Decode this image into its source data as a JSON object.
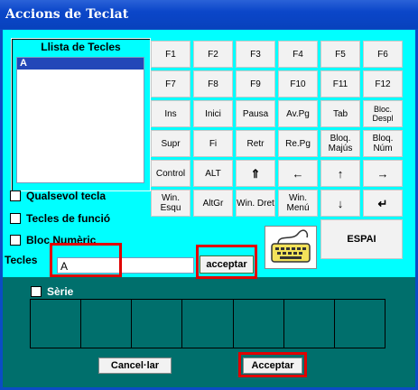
{
  "window": {
    "title": "Accions de Teclat"
  },
  "list": {
    "label": "Llista de Tecles",
    "items": [
      "A"
    ]
  },
  "keys": {
    "row1": [
      "F1",
      "F2",
      "F3",
      "F4",
      "F5",
      "F6"
    ],
    "row2": [
      "F7",
      "F8",
      "F9",
      "F10",
      "F11",
      "F12"
    ],
    "row3": [
      "Ins",
      "Inici",
      "Pausa",
      "Av.Pg",
      "Tab",
      "Bloc. Despl"
    ],
    "row4": [
      "Supr",
      "Fi",
      "Retr",
      "Re.Pg",
      "Bloq. Majús",
      "Bloq. Núm"
    ],
    "row5": [
      "Control",
      "ALT",
      "⇑",
      "←",
      "↑",
      "→"
    ],
    "row6": [
      "Win. Esqu",
      "AltGr",
      "Win. Dret",
      "Win. Menú",
      "↓",
      "↵"
    ],
    "space": "ESPAI"
  },
  "options": {
    "qualsevol": "Qualsevol tecla",
    "funcio": "Tecles de funció",
    "numeric": "Bloc Numèric"
  },
  "tecles": {
    "label": "Tecles",
    "value": "A",
    "button": "acceptar"
  },
  "serie": {
    "label": "Sèrie"
  },
  "footer": {
    "cancel": "Cancel·lar",
    "accept": "Acceptar"
  },
  "colors": {
    "panel": "#00ffff",
    "lower": "#006f6c",
    "highlight": "#e00000"
  }
}
